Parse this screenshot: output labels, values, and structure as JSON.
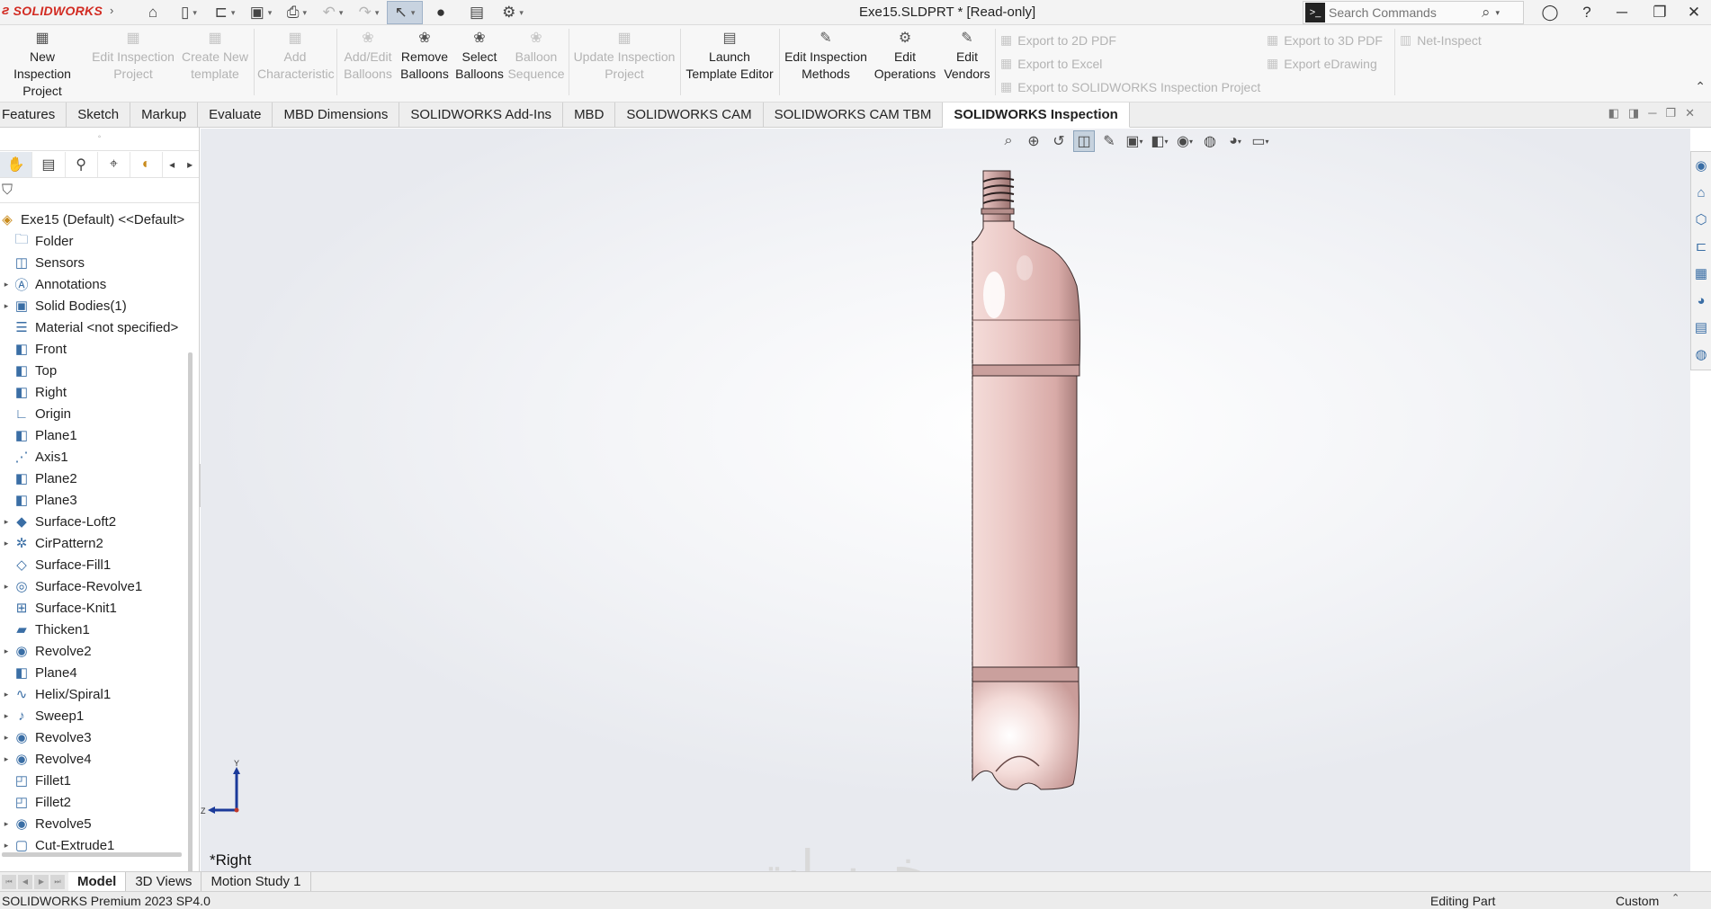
{
  "app": {
    "brand": "SOLIDWORKS",
    "window_title": "Exe15.SLDPRT * [Read-only]"
  },
  "search": {
    "placeholder": "Search Commands"
  },
  "ribbon": {
    "new_inspection_project": "New Inspection Project",
    "edit_inspection_project": "Edit Inspection Project",
    "create_new_template": "Create New template",
    "add_characteristic": "Add Characteristic",
    "add_edit_balloons": "Add/Edit Balloons",
    "remove_balloons": "Remove Balloons",
    "select_balloons": "Select Balloons",
    "balloon_sequence": "Balloon Sequence",
    "update_inspection_project": "Update Inspection Project",
    "launch_template_editor": "Launch Template Editor",
    "edit_inspection_methods": "Edit Inspection Methods",
    "edit_operations": "Edit Operations",
    "edit_vendors": "Edit Vendors",
    "export_2d_pdf": "Export to 2D PDF",
    "export_excel": "Export to Excel",
    "export_sw_inspection": "Export to SOLIDWORKS Inspection Project",
    "export_3d_pdf": "Export to 3D PDF",
    "export_edrawing": "Export eDrawing",
    "net_inspect": "Net-Inspect"
  },
  "tabs": [
    {
      "label": "Features",
      "active": false
    },
    {
      "label": "Sketch",
      "active": false
    },
    {
      "label": "Markup",
      "active": false
    },
    {
      "label": "Evaluate",
      "active": false
    },
    {
      "label": "MBD Dimensions",
      "active": false
    },
    {
      "label": "SOLIDWORKS Add-Ins",
      "active": false
    },
    {
      "label": "MBD",
      "active": false
    },
    {
      "label": "SOLIDWORKS CAM",
      "active": false
    },
    {
      "label": "SOLIDWORKS CAM TBM",
      "active": false
    },
    {
      "label": "SOLIDWORKS Inspection",
      "active": true
    }
  ],
  "tree": {
    "root": "Exe15 (Default) <<Default>",
    "items": [
      {
        "label": "Folder",
        "icon": "folder-icon",
        "expandable": false
      },
      {
        "label": "Sensors",
        "icon": "sensors-icon",
        "expandable": false
      },
      {
        "label": "Annotations",
        "icon": "annotations-icon",
        "expandable": true
      },
      {
        "label": "Solid Bodies(1)",
        "icon": "solid-bodies-icon",
        "expandable": true
      },
      {
        "label": "Material <not specified>",
        "icon": "material-icon",
        "expandable": false
      },
      {
        "label": "Front",
        "icon": "plane-icon",
        "expandable": false
      },
      {
        "label": "Top",
        "icon": "plane-icon",
        "expandable": false
      },
      {
        "label": "Right",
        "icon": "plane-icon",
        "expandable": false
      },
      {
        "label": "Origin",
        "icon": "origin-icon",
        "expandable": false
      },
      {
        "label": "Plane1",
        "icon": "plane-icon",
        "expandable": false
      },
      {
        "label": "Axis1",
        "icon": "axis-icon",
        "expandable": false
      },
      {
        "label": "Plane2",
        "icon": "plane-icon",
        "expandable": false
      },
      {
        "label": "Plane3",
        "icon": "plane-icon",
        "expandable": false
      },
      {
        "label": "Surface-Loft2",
        "icon": "surface-loft-icon",
        "expandable": true
      },
      {
        "label": "CirPattern2",
        "icon": "circular-pattern-icon",
        "expandable": true
      },
      {
        "label": "Surface-Fill1",
        "icon": "surface-fill-icon",
        "expandable": false
      },
      {
        "label": "Surface-Revolve1",
        "icon": "surface-revolve-icon",
        "expandable": true
      },
      {
        "label": "Surface-Knit1",
        "icon": "surface-knit-icon",
        "expandable": false
      },
      {
        "label": "Thicken1",
        "icon": "thicken-icon",
        "expandable": false
      },
      {
        "label": "Revolve2",
        "icon": "revolve-icon",
        "expandable": true
      },
      {
        "label": "Plane4",
        "icon": "plane-icon",
        "expandable": false
      },
      {
        "label": "Helix/Spiral1",
        "icon": "helix-icon",
        "expandable": true
      },
      {
        "label": "Sweep1",
        "icon": "sweep-icon",
        "expandable": true
      },
      {
        "label": "Revolve3",
        "icon": "revolve-icon",
        "expandable": true
      },
      {
        "label": "Revolve4",
        "icon": "revolve-icon",
        "expandable": true
      },
      {
        "label": "Fillet1",
        "icon": "fillet-icon",
        "expandable": false
      },
      {
        "label": "Fillet2",
        "icon": "fillet-icon",
        "expandable": false
      },
      {
        "label": "Revolve5",
        "icon": "revolve-icon",
        "expandable": true
      },
      {
        "label": "Cut-Extrude1",
        "icon": "cut-extrude-icon",
        "expandable": true
      }
    ]
  },
  "viewport": {
    "view_name": "*Right",
    "triad": {
      "y": "Y",
      "z": "Z"
    },
    "watermark": "خمسات",
    "model_color": "#e8c4c2"
  },
  "bottom_tabs": [
    {
      "label": "Model",
      "active": true
    },
    {
      "label": "3D Views",
      "active": false
    },
    {
      "label": "Motion Study 1",
      "active": false
    }
  ],
  "status": {
    "product": "SOLIDWORKS Premium 2023 SP4.0",
    "mode": "Editing Part",
    "units": "Custom"
  },
  "colors": {
    "brand_red": "#d22b22",
    "accent_blue": "#3a6ea5"
  }
}
